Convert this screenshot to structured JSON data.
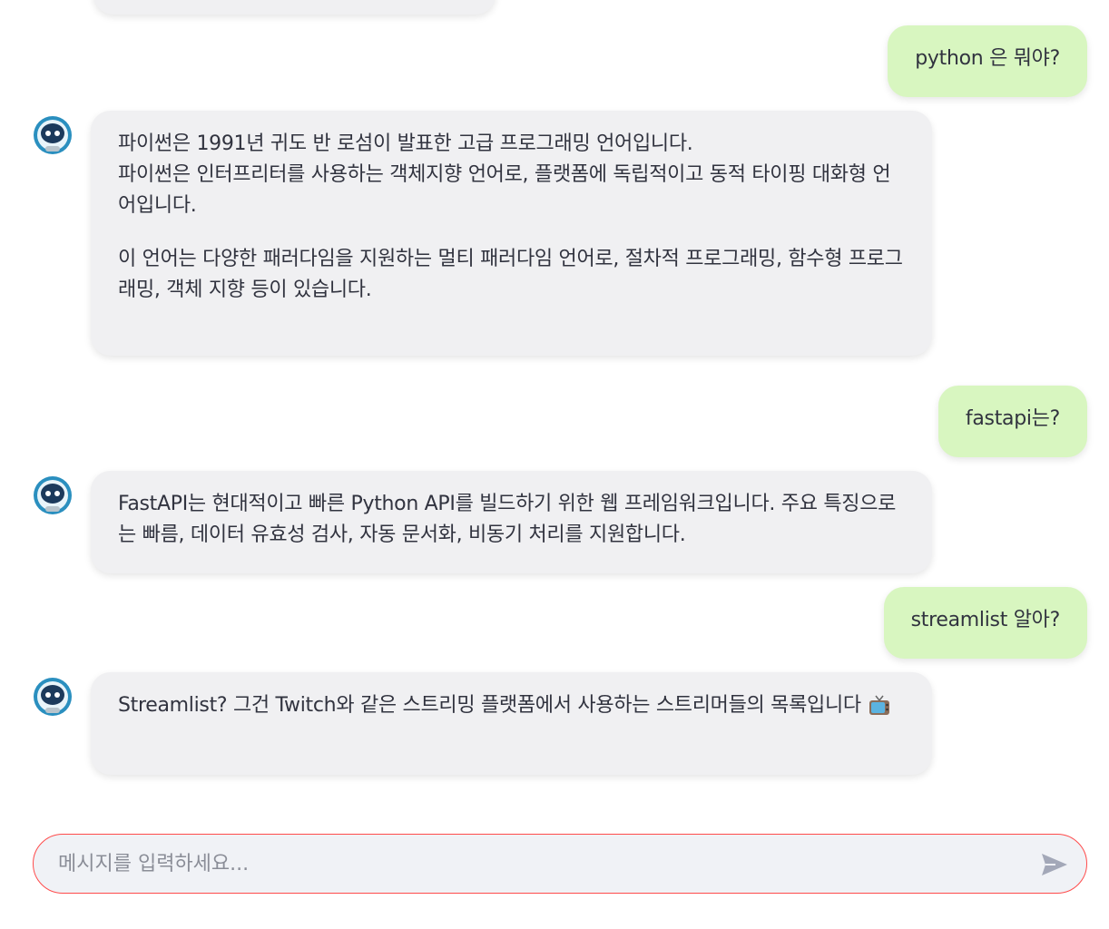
{
  "conversation": {
    "user_messages": [
      "python 은 뭐야?",
      "fastapi는?",
      "streamlist 알아?"
    ],
    "bot_messages": [
      {
        "paragraphs": [
          "파이썬은 1991년 귀도 반 로섬이 발표한 고급 프로그래밍 언어입니다.",
          "파이썬은 인터프리터를 사용하는 객체지향 언어로, 플랫폼에 독립적이고 동적 타이핑 대화형 언어입니다.",
          "이 언어는 다양한 패러다임을 지원하는 멀티 패러다임 언어로, 절차적 프로그래밍, 함수형 프로그래밍, 객체 지향 등이 있습니다."
        ]
      },
      {
        "paragraphs": [
          "FastAPI는 현대적이고 빠른 Python API를 빌드하기 위한 웹 프레임워크입니다. 주요 특징으로는 빠름, 데이터 유효성 검사, 자동 문서화, 비동기 처리를 지원합니다."
        ]
      },
      {
        "paragraphs": [
          "Streamlist? 그건 Twitch와 같은 스트리밍 플랫폼에서 사용하는 스트리머들의 목록입니다"
        ],
        "emoji": "television-emoji"
      }
    ],
    "avatar_icon": "robot-avatar-icon"
  },
  "input": {
    "placeholder": "메시지를 입력하세요...",
    "value": "",
    "send_icon": "send-icon"
  },
  "colors": {
    "user_bubble": "#d8f6c0",
    "bot_bubble": "#f0f0f2",
    "input_border": "#ff4b4b",
    "avatar_ring": "#2a8fbf"
  }
}
